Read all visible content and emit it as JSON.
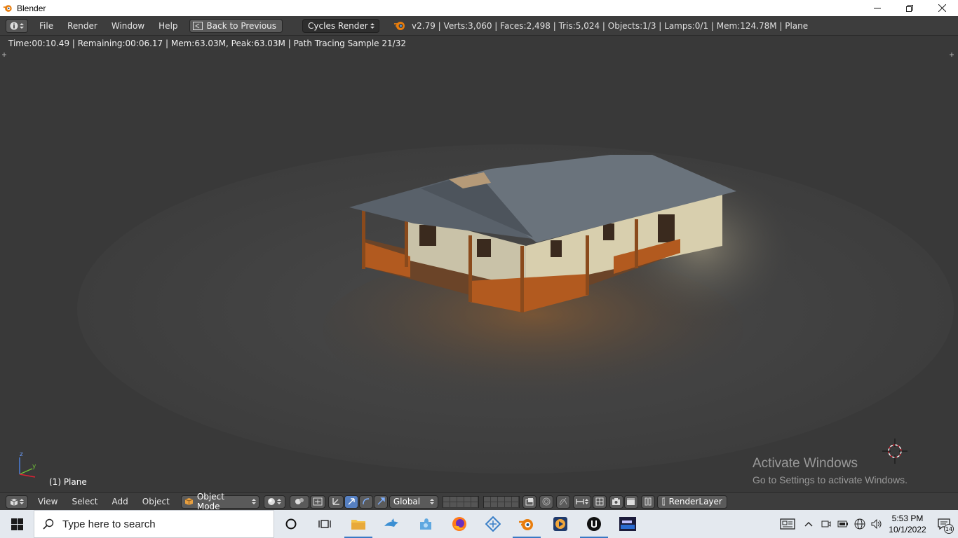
{
  "window": {
    "title": "Blender"
  },
  "info_header": {
    "menus": [
      "File",
      "Render",
      "Window",
      "Help"
    ],
    "back_button": "Back to Previous",
    "render_engine": "Cycles Render",
    "stats": "v2.79 | Verts:3,060 | Faces:2,498 | Tris:5,024 | Objects:1/3 | Lamps:0/1 | Mem:124.78M | Plane"
  },
  "viewport": {
    "render_info": "Time:00:10.49 | Remaining:00:06.17 | Mem:63.03M, Peak:63.03M | Path Tracing Sample 21/32",
    "object_label": "(1) Plane",
    "watermark_title": "Activate Windows",
    "watermark_sub": "Go to Settings to activate Windows."
  },
  "view_header": {
    "menus": [
      "View",
      "Select",
      "Add",
      "Object"
    ],
    "mode": "Object Mode",
    "orientation": "Global",
    "render_layer": "RenderLayer"
  },
  "taskbar": {
    "search_placeholder": "Type here to search",
    "time": "5:53 PM",
    "date": "10/1/2022",
    "notification_count": "14"
  },
  "colors": {
    "ui_dark": "#3d3d3d",
    "viewport_bg": "#393939",
    "taskbar_bg": "#e4e9ef",
    "accent": "#e87d0d"
  }
}
